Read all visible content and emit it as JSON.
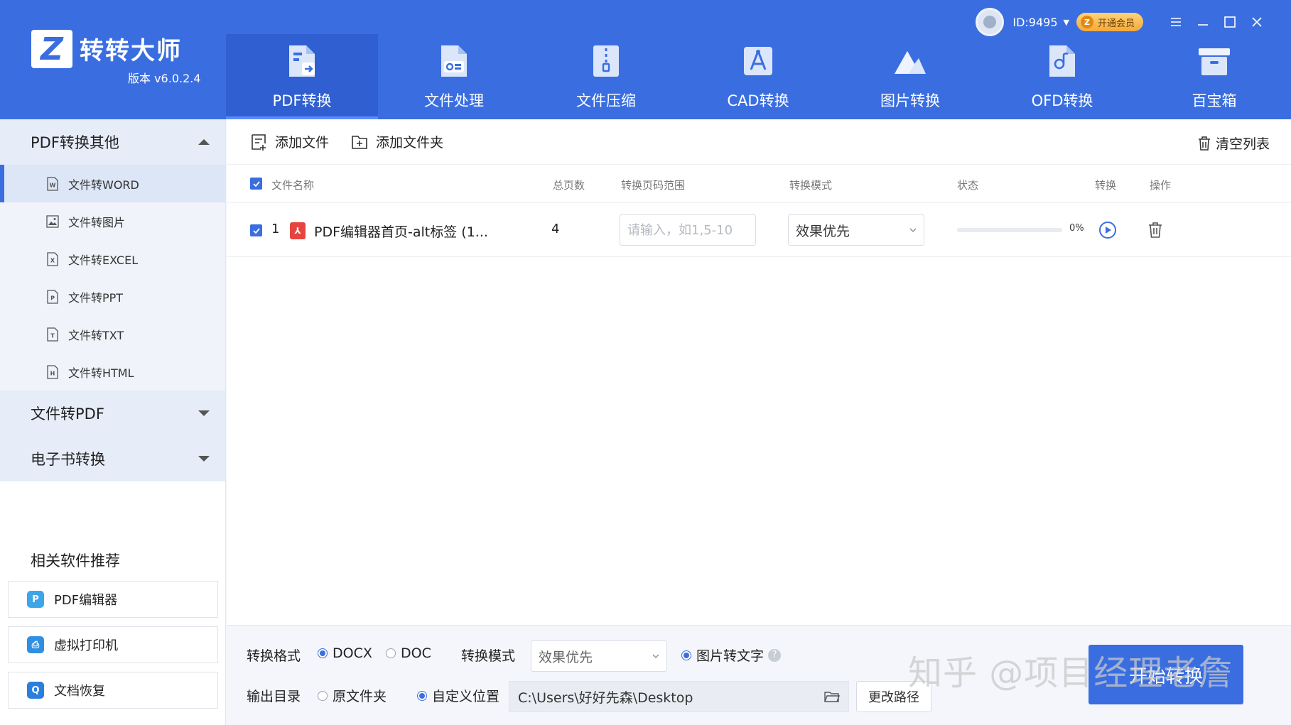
{
  "app": {
    "name": "转转大师",
    "version": "版本 v6.0.2.4",
    "logo_letter": "Z"
  },
  "user": {
    "id": "ID:9495",
    "vip_label": "开通会员",
    "vip_badge": "Z"
  },
  "nav": [
    {
      "label": "PDF转换",
      "icon": "pdf-convert-icon",
      "active": true
    },
    {
      "label": "文件处理",
      "icon": "file-process-icon",
      "active": false
    },
    {
      "label": "文件压缩",
      "icon": "file-compress-icon",
      "active": false
    },
    {
      "label": "CAD转换",
      "icon": "cad-convert-icon",
      "active": false
    },
    {
      "label": "图片转换",
      "icon": "image-convert-icon",
      "active": false
    },
    {
      "label": "OFD转换",
      "icon": "ofd-convert-icon",
      "active": false
    },
    {
      "label": "百宝箱",
      "icon": "toolbox-icon",
      "active": false
    }
  ],
  "sidebar": {
    "group1": {
      "title": "PDF转换其他",
      "items": [
        {
          "label": "文件转WORD",
          "letter": "W"
        },
        {
          "label": "文件转图片",
          "letter": "img"
        },
        {
          "label": "文件转EXCEL",
          "letter": "X"
        },
        {
          "label": "文件转PPT",
          "letter": "P"
        },
        {
          "label": "文件转TXT",
          "letter": "T"
        },
        {
          "label": "文件转HTML",
          "letter": "H"
        }
      ]
    },
    "group2": {
      "title": "文件转PDF"
    },
    "group3": {
      "title": "电子书转换"
    },
    "recommend": {
      "title": "相关软件推荐",
      "items": [
        {
          "label": "PDF编辑器",
          "color": "#3da5e8",
          "glyph": "P"
        },
        {
          "label": "虚拟打印机",
          "color": "#2f8fe0",
          "glyph": "⎙"
        },
        {
          "label": "文档恢复",
          "color": "#2a7fdc",
          "glyph": "Q"
        }
      ]
    }
  },
  "toolbar": {
    "add_file": "添加文件",
    "add_folder": "添加文件夹",
    "clear_list": "清空列表"
  },
  "table": {
    "headers": {
      "name": "文件名称",
      "pages": "总页数",
      "range": "转换页码范围",
      "mode": "转换模式",
      "status": "状态",
      "convert": "转换",
      "action": "操作"
    },
    "rows": [
      {
        "index": "1",
        "name": "PDF编辑器首页-alt标签 (1...",
        "pages": "4",
        "range_placeholder": "请输入，如1,5-10",
        "mode": "效果优先",
        "progress_text": "0%",
        "progress": 0
      }
    ]
  },
  "bottom": {
    "format_label": "转换格式",
    "format_docx": "DOCX",
    "format_doc": "DOC",
    "mode_label": "转换模式",
    "mode_value": "效果优先",
    "ocr_label": "图片转文字",
    "ocr_help": "?",
    "output_label": "输出目录",
    "output_original": "原文件夹",
    "output_custom": "自定义位置",
    "output_path": "C:\\Users\\好好先森\\Desktop",
    "change_path": "更改路径",
    "start": "开始转换"
  },
  "watermark": "知乎 @项目经理老詹",
  "colors": {
    "accent": "#3a6ee0",
    "header": "#3a6ee0"
  }
}
